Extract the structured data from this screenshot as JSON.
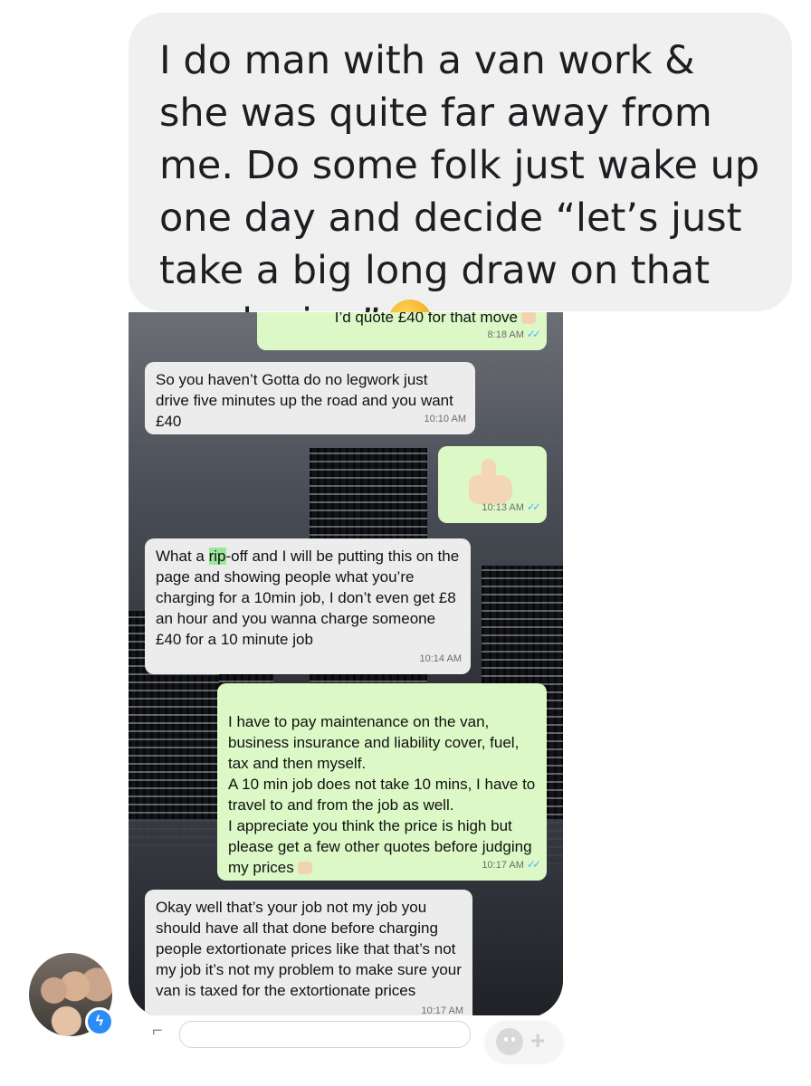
{
  "top_message": {
    "text": "I do man with a van work & she was quite far away from me. Do some folk just wake up one day and decide “let’s just take a big long draw on that crack pipe”",
    "emoji": "thinking-face-icon"
  },
  "chat": {
    "messages": [
      {
        "direction": "out",
        "text": "I’d quote £40 for that move",
        "time": "8:18 AM",
        "ticks": "✓✓"
      },
      {
        "direction": "in",
        "text": "So you haven’t Gotta do no legwork just drive five minutes up the road and you want £40",
        "time": "10:10 AM"
      },
      {
        "direction": "out",
        "text": "",
        "time": "10:13 AM",
        "ticks": "✓✓"
      },
      {
        "direction": "in",
        "text_before": "What a ",
        "text_highlight": "rip",
        "text_after": "-off and I will be putting this on the page and showing people what you’re charging for a 10min job, I don’t even get £8 an hour and you wanna charge someone £40 for a 10 minute job",
        "time": "10:14 AM"
      },
      {
        "direction": "out",
        "text": "I have to pay maintenance on the van, business insurance and liability cover, fuel, tax and then myself.\nA 10 min job does not take 10 mins, I have to travel to and from the job as well.\nI appreciate you think the price is high but please get a few other quotes before judging my prices",
        "time": "10:17 AM",
        "ticks": "✓✓"
      },
      {
        "direction": "in",
        "text": "Okay well that’s your job not my job you should have all that done before charging people extortionate prices like that that’s not my job it’s not my problem to make sure your van is taxed for the extortionate prices",
        "time": "10:17 AM"
      }
    ]
  }
}
